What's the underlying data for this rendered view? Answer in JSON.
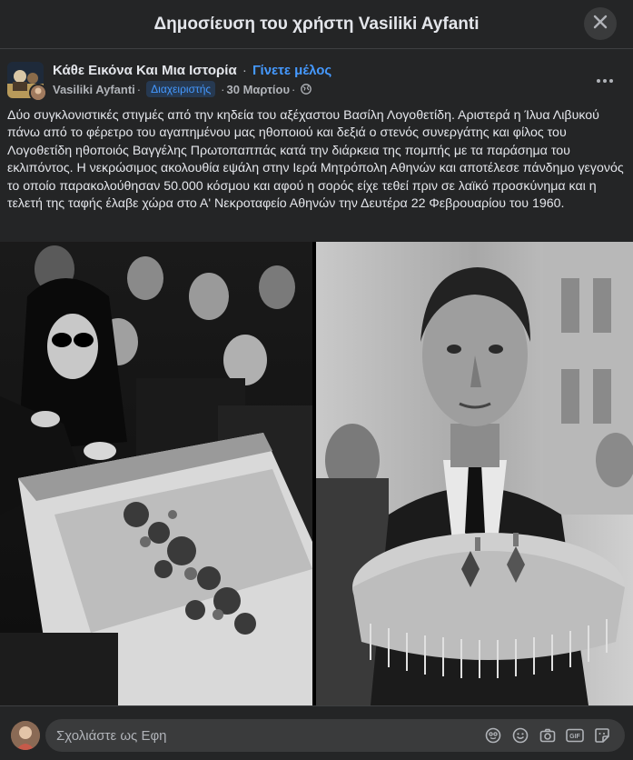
{
  "header": {
    "title": "Δημοσίευση του χρήστη Vasiliki Ayfanti",
    "close_icon": "close-icon"
  },
  "post": {
    "group_name": "Κάθε Εικόνα Και Μια Ιστορία",
    "separator": "·",
    "join_label": "Γίνετε μέλος",
    "author": "Vasiliki Ayfanti",
    "admin_badge": "Διαχειριστής",
    "date": "30 Μαρτίου",
    "privacy_icon": "globe-icon",
    "more_icon": "more-icon",
    "text": "Δύο συγκλονιστικές στιγμές από την κηδεία του αξέχαστου Βασίλη Λογοθετίδη. Αριστερά η Ίλυα Λιβυκού πάνω από το φέρετρο του αγαπημένου μας ηθοποιού και δεξιά ο στενός συνεργάτης και φίλος του Λογοθετίδη ηθοποιός Βαγγέλης Πρωτοπαππάς κατά την διάρκεια της πομπής με τα παράσημα του εκλιπόντος. Η νεκρώσιμος ακολουθία εψάλη στην Ιερά Μητρόπολη Αθηνών και αποτέλεσε πάνδημο γεγονός το οποίο παρακολούθησαν 50.000 κόσμου και αφού η σορός είχε τεθεί πριν σε λαϊκό προσκύνημα και η τελετή της ταφής έλαβε χώρα στο Α' Νεκροταφείο Αθηνών την Δευτέρα 22 Φεβρουαρίου του 1960."
  },
  "comment": {
    "placeholder": "Σχολιάστε ως Εφη",
    "icons": [
      "avatar-sticker-icon",
      "emoji-icon",
      "camera-icon",
      "gif-icon",
      "sticker-icon"
    ]
  },
  "colors": {
    "background": "#242526",
    "text": "#e4e6eb",
    "secondary": "#b0b3b8",
    "link": "#4599ff",
    "input_bg": "#3a3b3c"
  }
}
